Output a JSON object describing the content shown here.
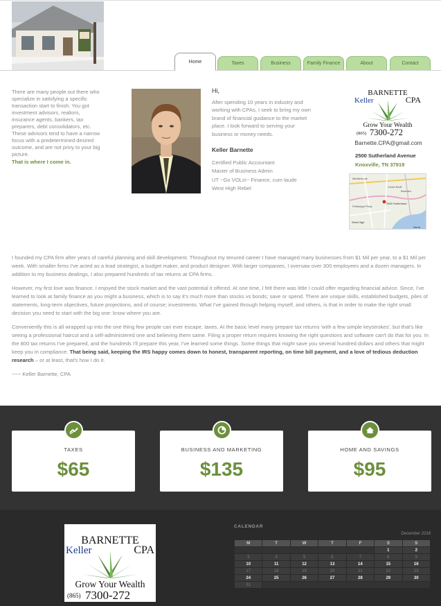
{
  "nav": {
    "tabs": [
      {
        "label": "Home",
        "active": true
      },
      {
        "label": "Taxes",
        "active": false
      },
      {
        "label": "Business",
        "active": false
      },
      {
        "label": "Family Finance",
        "active": false
      },
      {
        "label": "About",
        "active": false
      },
      {
        "label": "Contact",
        "active": false
      }
    ]
  },
  "intro": {
    "text": "There are many people out there who specialize in satisfying a specific transaction start to finish. You got investment advisors, realtors, insurance agents, bankers, tax preparers, debt consolidators, etc. These advisors tend to have a narrow focus with a predetermined desired outcome, and are not privy to your big picture.",
    "tagline": "That is where I come in."
  },
  "greeting": {
    "hi": "Hi,",
    "body": "After spending 10 years in industry and working with CPAs, I seek to bring my own brand of financial guidance to the market place. I look forward to serving your business or money needs.",
    "name": "Keller Barnette",
    "credentials": [
      "Certified Public Accountant",
      "Master of Business Admin",
      "UT ~Go VOLs!~ Finance, cum laude",
      "West High Rebel"
    ]
  },
  "logo": {
    "line1": "BARNETTE",
    "line2a": "Keller",
    "line2b": "CPA",
    "slogan": "Grow Your Wealth",
    "area": "(865)",
    "phone": "7300-272"
  },
  "contact": {
    "email": "Barnette.CPA@gmail.com",
    "street": "2500 Sutherland Avenue",
    "city": "Knoxville, TN 37919"
  },
  "map": {
    "labels": [
      "Middlebrook",
      "Cedar Bluff",
      "Bearden",
      "2500 Sutherland",
      "West High",
      "Alcoa",
      "Pellissippi Pkwy"
    ]
  },
  "story": {
    "p1": "I founded my CPA firm after years of careful planning and skill development. Throughout my tenured career I have managed many businesses from $1 Mil per year, to a $1 Mil per week. With smaller firms I've acted as a lead strategist, a budget maker, and product designer. With larger companies, I oversaw over 300 employees and a dozen managers. In addition to my business dealings, I also prepared hundreds of tax returns at CPA firms.",
    "p2": "However, my first love was finance. I enjoyed the stock market and the vast potential it offered. At one time, I felt there was little I could offer regarding financial advice. Since, I've learned to look at family finance as you might a business, which is to say it's much more than stocks vs bonds; save or spend. There are unique skills, established budgets, piles of statements, long-term objectives, future projections, and of course; investments. What I've gained through helping myself, and others, is that in order to make the right small decision you need to start with the big one: know where you are.",
    "p3_plain": "Conveniently this is all wrapped up into the one thing few people can ever escape, taxes. At the basic level many prepare tax returns 'with a few simple keystrokes', but that's like seeing a professional haircut and a self-administered one and believing them same. Filing a proper return requires knowing the right questions and software can't do that for you. In the 800 tax returns I've prepared, and the hundreds I'll prepare this year, I've learned some things. Some things that might save you several hundred dollars and others that might keep you in compliance.",
    "p3_bold": "That being said, keeping the IRS happy comes down to honest, transparent reporting, on time bill payment, and a love of tedious deduction research",
    "p3_tail": " – or at least, that's how I do it.",
    "signoff": "~~~ Keller Barnette, CPA"
  },
  "prices": [
    {
      "label": "TAXES",
      "value": "$65",
      "icon": "chart-trend-icon"
    },
    {
      "label": "BUSINESS AND MARKETING",
      "value": "$135",
      "icon": "pie-chart-icon"
    },
    {
      "label": "HOME AND SAVINGS",
      "value": "$95",
      "icon": "home-icon"
    }
  ],
  "calendar": {
    "title": "CALENDAR",
    "caption": "December 2018",
    "days": [
      "M",
      "T",
      "W",
      "T",
      "F",
      "S",
      "S"
    ],
    "weeks": [
      [
        "",
        "",
        "",
        "",
        "",
        "1",
        "2"
      ],
      [
        "3",
        "4",
        "5",
        "6",
        "7",
        "8",
        "9"
      ],
      [
        "10",
        "11",
        "12",
        "13",
        "14",
        "15",
        "16"
      ],
      [
        "17",
        "18",
        "19",
        "20",
        "21",
        "22",
        "23"
      ],
      [
        "24",
        "25",
        "26",
        "27",
        "28",
        "29",
        "30"
      ],
      [
        "31",
        "",
        "",
        "",
        "",
        "",
        ""
      ]
    ]
  },
  "colors": {
    "brand_green": "#6c8f3c",
    "tab_green": "#b9dd9e",
    "dark_band": "#333333",
    "footer": "#2a2a2a"
  }
}
